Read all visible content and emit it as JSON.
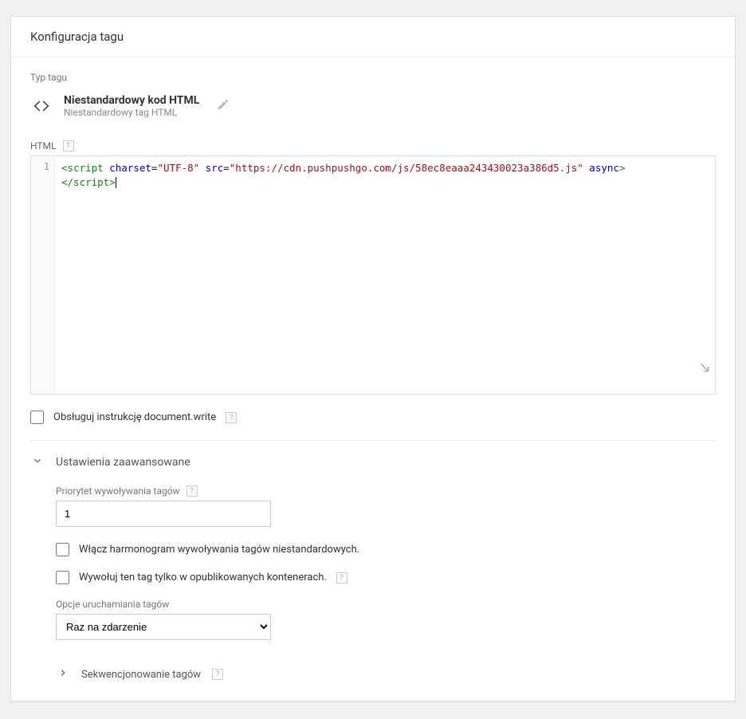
{
  "header": {
    "title": "Konfiguracja tagu"
  },
  "tagType": {
    "sectionLabel": "Typ tagu",
    "title": "Niestandardowy kod HTML",
    "subtitle": "Niestandardowy tag HTML"
  },
  "htmlField": {
    "label": "HTML",
    "lineNumber": "1",
    "code": {
      "open": "<script",
      "attr_charset": " charset",
      "eq1": "=",
      "val_charset": "\"UTF-8\"",
      "attr_src": " src",
      "eq2": "=",
      "val_src": "\"https://cdn.pushpushgo.com/js/58ec8eaaa243430023a386d5.js\"",
      "attr_async": " async",
      "gt": ">",
      "close": "</script>"
    }
  },
  "docwrite": {
    "label": "Obsługuj instrukcję document.write"
  },
  "advanced": {
    "title": "Ustawienia zaawansowane",
    "priority": {
      "label": "Priorytet wywoływania tagów",
      "value": "1"
    },
    "schedule": {
      "label": "Włącz harmonogram wywoływania tagów niestandardowych."
    },
    "publishedOnly": {
      "label": "Wywołuj ten tag tylko w opublikowanych kontenerach."
    },
    "firingOptions": {
      "label": "Opcje uruchamiania tagów",
      "value": "Raz na zdarzenie"
    },
    "sequencing": {
      "label": "Sekwencjonowanie tagów"
    }
  },
  "help": "?"
}
